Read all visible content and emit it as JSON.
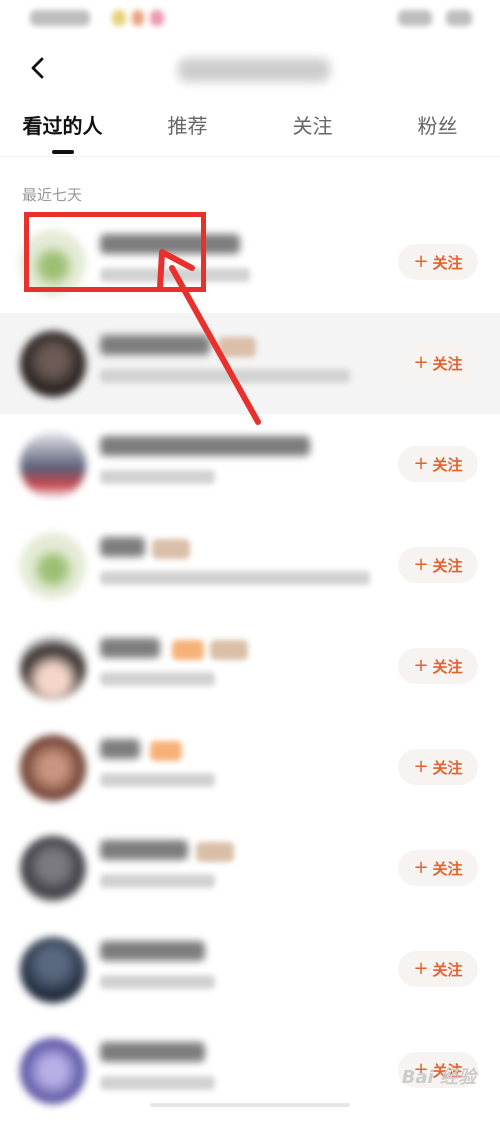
{
  "tabs": [
    {
      "label": "看过的人",
      "active": true
    },
    {
      "label": "推荐",
      "active": false
    },
    {
      "label": "关注",
      "active": false
    },
    {
      "label": "粉丝",
      "active": false
    }
  ],
  "section_label": "最近七天",
  "follow_label": "关注",
  "follow_plus": "+",
  "accent_color": "#e2622e",
  "annotation_color": "#e8302c",
  "watermark": "Bai 经验",
  "users": [
    {
      "avatar_color": "#d9e2c7",
      "highlight": false
    },
    {
      "avatar_color": "#3a2f2c",
      "highlight": true
    },
    {
      "avatar_color": "#d3d3dc",
      "highlight": false
    },
    {
      "avatar_color": "#cfdcbc",
      "highlight": false
    },
    {
      "avatar_color": "#2f2a29",
      "highlight": false
    },
    {
      "avatar_color": "#8a5a47",
      "highlight": false
    },
    {
      "avatar_color": "#555457",
      "highlight": false
    },
    {
      "avatar_color": "#2e3a4f",
      "highlight": false
    },
    {
      "avatar_color": "#6f6bb2",
      "highlight": false
    }
  ]
}
